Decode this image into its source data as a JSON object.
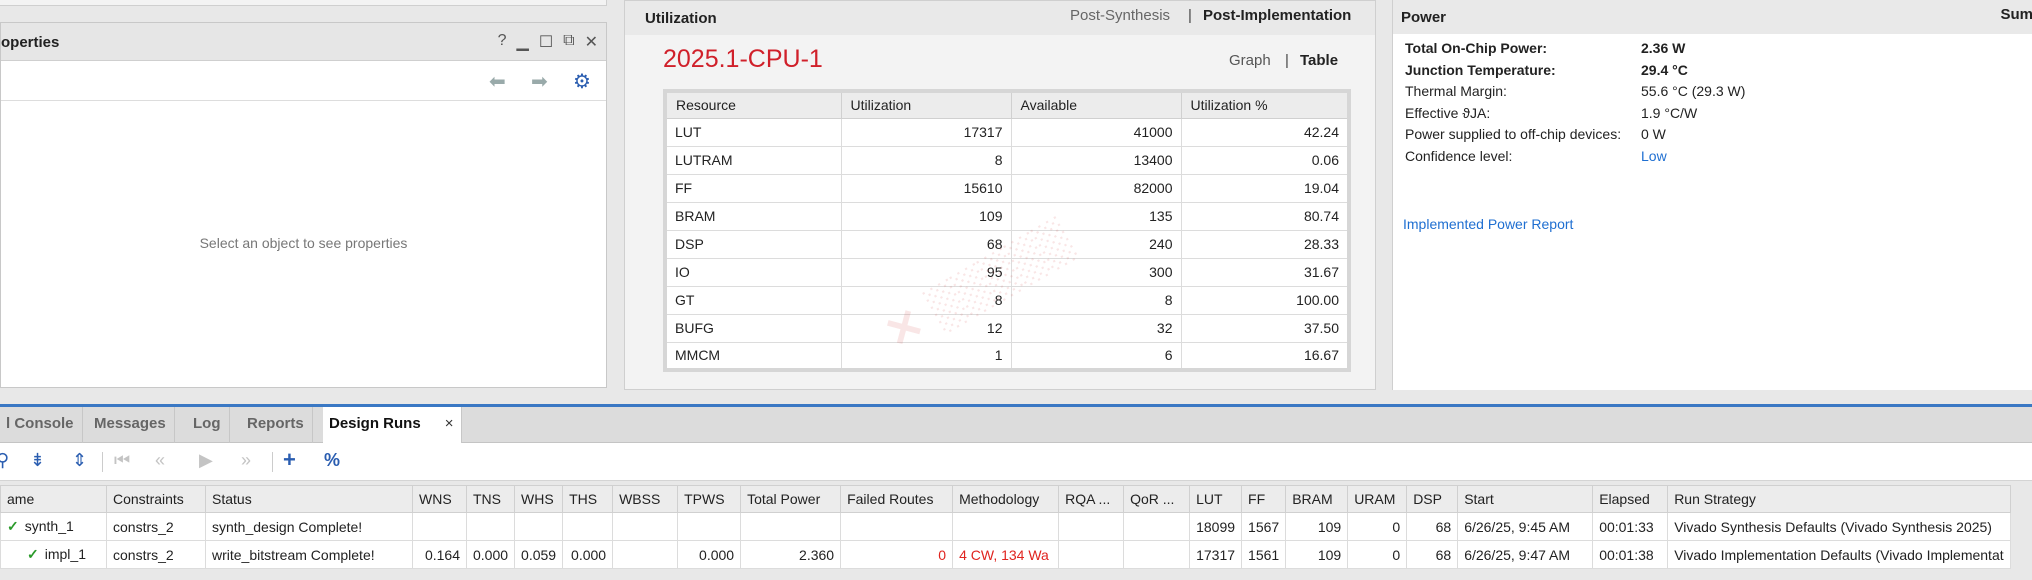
{
  "properties": {
    "title": "operties",
    "help_glyph": "?",
    "empty_message": "Select an object to see properties"
  },
  "utilization": {
    "title": "Utilization",
    "tabs": [
      "Post-Synthesis",
      "Post-Implementation"
    ],
    "device": "2025.1-CPU-1",
    "view_tabs": [
      "Graph",
      "Table"
    ],
    "columns": [
      "Resource",
      "Utilization",
      "Available",
      "Utilization %"
    ],
    "rows": [
      [
        "LUT",
        "17317",
        "41000",
        "42.24"
      ],
      [
        "LUTRAM",
        "8",
        "13400",
        "0.06"
      ],
      [
        "FF",
        "15610",
        "82000",
        "19.04"
      ],
      [
        "BRAM",
        "109",
        "135",
        "80.74"
      ],
      [
        "DSP",
        "68",
        "240",
        "28.33"
      ],
      [
        "IO",
        "95",
        "300",
        "31.67"
      ],
      [
        "GT",
        "8",
        "8",
        "100.00"
      ],
      [
        "BUFG",
        "12",
        "32",
        "37.50"
      ],
      [
        "MMCM",
        "1",
        "6",
        "16.67"
      ]
    ]
  },
  "power": {
    "title": "Power",
    "summary_label": "Sum",
    "rows": [
      {
        "label": "Total On-Chip Power:",
        "value": "2.36 W"
      },
      {
        "label": "Junction Temperature:",
        "value": "29.4 °C"
      },
      {
        "label": "Thermal Margin:",
        "value": "55.6 °C (29.3 W)"
      },
      {
        "label": "Effective ϑJA:",
        "value": "1.9 °C/W"
      },
      {
        "label": "Power supplied to off-chip devices:",
        "value": "0 W"
      },
      {
        "label": "Confidence level:",
        "value": "Low"
      }
    ],
    "report_link": "Implemented Power Report"
  },
  "dock": {
    "tabs": [
      "l Console",
      "Messages",
      "Log",
      "Reports",
      "Design Runs"
    ],
    "close_glyph": "×",
    "toolbar_icons": [
      "search-icon",
      "collapse-all-icon",
      "expand-all-icon",
      "first-icon",
      "previous-icon",
      "play-icon",
      "next-icon",
      "add-icon",
      "percent-icon"
    ],
    "percent_glyph": "%",
    "add_glyph": "+"
  },
  "runs": {
    "columns": [
      "ame",
      "Constraints",
      "Status",
      "WNS",
      "TNS",
      "WHS",
      "THS",
      "WBSS",
      "TPWS",
      "Total Power",
      "Failed Routes",
      "Methodology",
      "RQA ...",
      "QoR ...",
      "LUT",
      "FF",
      "BRAM",
      "URAM",
      "DSP",
      "Start",
      "Elapsed",
      "Run Strategy"
    ],
    "rows": [
      [
        "synth_1",
        "constrs_2",
        "synth_design Complete!",
        "",
        "",
        "",
        "",
        "",
        "",
        "",
        "",
        "",
        "",
        "",
        "18099",
        "1567",
        "109",
        "0",
        "68",
        "6/26/25, 9:45 AM",
        "00:01:33",
        "Vivado Synthesis Defaults (Vivado Synthesis 2025)"
      ],
      [
        "impl_1",
        "constrs_2",
        "write_bitstream Complete!",
        "0.164",
        "0.000",
        "0.059",
        "0.000",
        "",
        "0.000",
        "2.360",
        "0",
        "4 CW, 134 Wa",
        "",
        "",
        "17317",
        "1561",
        "109",
        "0",
        "68",
        "6/26/25, 9:47 AM",
        "00:01:38",
        "Vivado Implementation Defaults (Vivado Implementat"
      ]
    ]
  },
  "colors": {
    "accent_blue": "#3a78c4",
    "device_red": "#d0202a",
    "link_blue": "#1f6fd1",
    "warning_red": "#e0241f",
    "check_green": "#2a9a2a"
  }
}
